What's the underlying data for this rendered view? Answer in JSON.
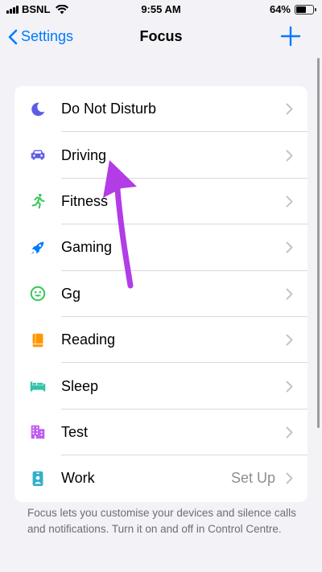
{
  "status_bar": {
    "carrier": "BSNL",
    "time": "9:55 AM",
    "battery": "64%",
    "battery_level": 0.64,
    "icons": [
      "signal-icon",
      "wifi-icon",
      "battery-icon"
    ]
  },
  "nav": {
    "back_label": "Settings",
    "title": "Focus",
    "add_icon": "plus-icon",
    "accent_color": "#007aff"
  },
  "focus_list": [
    {
      "id": "do-not-disturb",
      "label": "Do Not Disturb",
      "value": "",
      "icon": "moon-icon",
      "color": "#5e5ce6"
    },
    {
      "id": "driving",
      "label": "Driving",
      "value": "",
      "icon": "car-icon",
      "color": "#5e5ce6"
    },
    {
      "id": "fitness",
      "label": "Fitness",
      "value": "",
      "icon": "runner-icon",
      "color": "#34c759"
    },
    {
      "id": "gaming",
      "label": "Gaming",
      "value": "",
      "icon": "rocket-icon",
      "color": "#007aff"
    },
    {
      "id": "gg",
      "label": "Gg",
      "value": "",
      "icon": "smiley-icon",
      "color": "#34c759"
    },
    {
      "id": "reading",
      "label": "Reading",
      "value": "",
      "icon": "book-icon",
      "color": "#ff9500"
    },
    {
      "id": "sleep",
      "label": "Sleep",
      "value": "",
      "icon": "bed-icon",
      "color": "#30c3a8"
    },
    {
      "id": "test",
      "label": "Test",
      "value": "",
      "icon": "building-icon",
      "color": "#bf5af2"
    },
    {
      "id": "work",
      "label": "Work",
      "value": "Set Up",
      "icon": "id-badge-icon",
      "color": "#30b0c7"
    }
  ],
  "footer": {
    "text": "Focus lets you customise your devices and silence calls and notifications. Turn it on and off in Control Centre."
  },
  "annotation": {
    "icon": "arrow-annotation-icon",
    "color": "#b23ce6"
  }
}
